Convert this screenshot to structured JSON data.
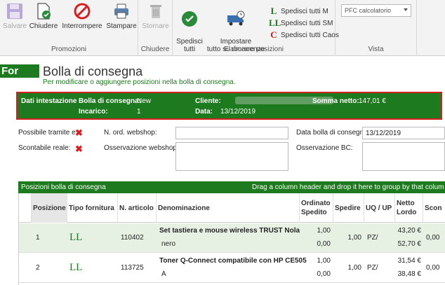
{
  "ribbon": {
    "buttons": {
      "salvare": "Salvare",
      "chiudere": "Chiudere",
      "interrompere": "Interrompere",
      "stampare": "Stampare",
      "stornare": "Stornare",
      "spedisci_tutti": "Spedisci\ntutti",
      "impostare": "Impostare\ntutto su rimanenze"
    },
    "groups": {
      "promozioni": "Promozioni",
      "chiudere": "Chiudere",
      "elaborare": "Elaborare posizioni",
      "vista": "Vista"
    },
    "spedisci": [
      {
        "icon": "L",
        "label": "Spedisci tutti M",
        "color": "#1e7a1e"
      },
      {
        "icon": "LL",
        "label": "Spedisci tutti SM",
        "color": "#1e7a1e"
      },
      {
        "icon": "C",
        "label": "Spedisci tutti Caos",
        "color": "#c41a1a"
      }
    ],
    "vista_combo": "PFC calcolatorio"
  },
  "page": {
    "side_label": "For",
    "title": "Bolla di consegna",
    "subtitle": "Per modificare o aggiungere posizioni nella bolla di consegna."
  },
  "header": {
    "dati": "Dati intestazione",
    "bolla_label": "Bolla di consegna:",
    "bolla_value": "New",
    "incarico_label": "Incarico:",
    "incarico_value": "1",
    "cliente_label": "Cliente:",
    "data_label": "Data:",
    "data_value": "13/12/2019",
    "somma_label": "Somma netto:",
    "somma_value": "147,01 €"
  },
  "form": {
    "possibile": "Possibile tramite e",
    "scontabile": "Scontabile reale:",
    "nord": "N. ord. webshop:",
    "osservazione": "Osservazione webshop:",
    "data_bolla": "Data bolla di consegn",
    "data_bolla_value": "13/12/2019",
    "osservazione_bc": "Osservazione BC:"
  },
  "grid": {
    "title": "Posizioni bolla di consegna",
    "drag_hint": "Drag a column header and drop it here to group by that colum",
    "columns": [
      "Posizione",
      "Tipo fornitura",
      "N. articolo",
      "Denominazione",
      "Ordinato Spedito",
      "Spedire",
      "UQ / UP",
      "Netto Lordo",
      "Scon"
    ],
    "rows": [
      {
        "pos": "1",
        "tipo": "LL",
        "art": "110402",
        "den1": "Set tastiera e mouse wireless TRUST Nola",
        "den2": "nero",
        "ord": "1,00",
        "sped": "0,00",
        "spedire": "1,00",
        "uq": "PZ/",
        "netto": "43,20 €",
        "lordo": "52,70 €",
        "scon": "0,00"
      },
      {
        "pos": "2",
        "tipo": "LL",
        "art": "113725",
        "den1": "Toner Q-Connect compatibile con HP CE505",
        "den2": "A",
        "ord": "1,00",
        "sped": "0,00",
        "spedire": "1,00",
        "uq": "PZ/",
        "netto": "31,54 €",
        "lordo": "38,48 €",
        "scon": "0,00"
      }
    ]
  }
}
